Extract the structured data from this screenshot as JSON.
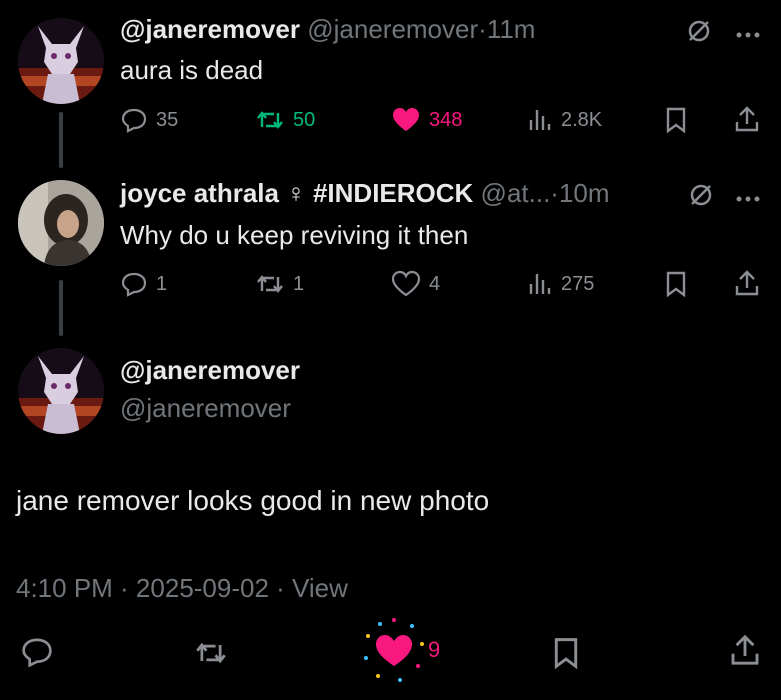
{
  "tweets": [
    {
      "name": "@janeremover",
      "handle": "@janeremover",
      "sep": "·",
      "time": "11m",
      "text": "aura is dead",
      "replies": "35",
      "reposts": "50",
      "likes": "348",
      "views": "2.8K"
    },
    {
      "name": "joyce athrala",
      "emoji": "♀",
      "hashtag": "#INDIEROCK",
      "handle": "@at...",
      "sep": "·",
      "time": "10m",
      "text": "Why do u keep reviving it then",
      "replies": "1",
      "reposts": "1",
      "likes": "4",
      "views": "275"
    }
  ],
  "main": {
    "name": "@janeremover",
    "handle": "@janeremover",
    "text": "jane remover looks good in new photo",
    "timestamp": "4:10 PM · 2025-09-02 · View",
    "likes": "9"
  },
  "colors": {
    "repost_active": "#00ba7c",
    "like_active": "#f91880",
    "muted": "#71767b"
  },
  "icons": [
    "reply-icon",
    "repost-icon",
    "heart-icon",
    "views-icon",
    "bookmark-icon",
    "share-icon",
    "grok-icon",
    "more-icon"
  ]
}
